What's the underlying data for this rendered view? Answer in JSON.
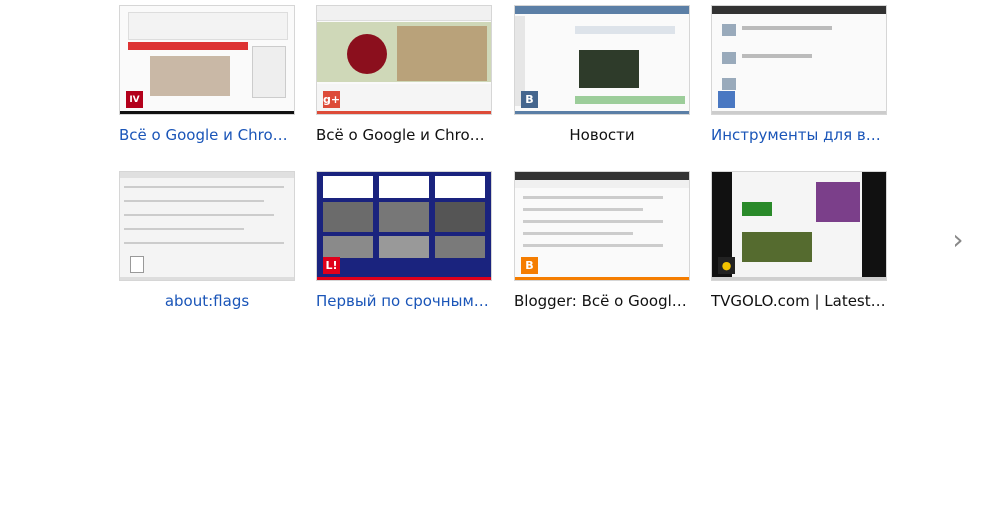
{
  "tiles": [
    {
      "title": "Всё о Google и Chrome",
      "style": "link",
      "favicon": "IV",
      "favicon_color": "#b3001b",
      "bar_color": "#111111"
    },
    {
      "title": "Всё о Google и Chrom…",
      "style": "plain",
      "favicon": "g+",
      "favicon_color": "#dd4b39",
      "bar_color": "#dd4b39"
    },
    {
      "title": "Новости",
      "style": "plain",
      "favicon": "В",
      "favicon_color": "#45668e",
      "bar_color": "#5b7fa6"
    },
    {
      "title": "Инструменты для веб…",
      "style": "link",
      "favicon": "",
      "favicon_color": "#4a78c2",
      "bar_color": "#cccccc"
    },
    {
      "title": "about:flags",
      "style": "link",
      "favicon": "",
      "favicon_color": "#ffffff",
      "bar_color": "#dddddd"
    },
    {
      "title": "Первый по срочным …",
      "style": "link",
      "favicon": "L!",
      "favicon_color": "#e0001b",
      "bar_color": "#e0001b"
    },
    {
      "title": "Blogger: Всё о Google…",
      "style": "plain",
      "favicon": "B",
      "favicon_color": "#f57d00",
      "bar_color": "#f57d00"
    },
    {
      "title": "TVGOLO.com | Latest …",
      "style": "plain",
      "favicon": "●",
      "favicon_color": "#222222",
      "bar_color": "#cfcfcf"
    }
  ],
  "navigation": {
    "next_glyph": "›"
  }
}
